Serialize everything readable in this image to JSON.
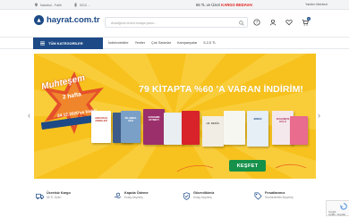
{
  "topbar": {
    "location": "İstanbul - Fatih",
    "phone": "0212 ...",
    "shipping_prefix": "65 TL ve Üzeri",
    "shipping_highlight": "KARGO BEDAVA!",
    "contact": "Yardım Merkezi"
  },
  "header": {
    "logo_text": "hayrat.com.tr",
    "search_placeholder": "Aradığınız ürünü buraya yazın...",
    "cart_count": "0"
  },
  "nav": {
    "all_categories": "TÜM KATEGORİLER",
    "links": [
      "İndirimdekiler",
      "Yeniler",
      "Çok Satanlar",
      "Kampanyalar",
      "5-2,5 TL"
    ]
  },
  "banner": {
    "badge_line1": "Muhteşem",
    "badge_line2": "2 hafta",
    "badge_line3": "24.12.2020'ye kadar",
    "headline": "79 KİTAPTA %60 'A VARAN İNDİRİM!",
    "cta": "KEŞFET",
    "books": [
      {
        "title": "ARKADAŞ ANNELER",
        "color": "#ffffff",
        "text_color": "#c0392b"
      },
      {
        "title": "",
        "color": "#3d5c8a",
        "text_color": "#ffffff"
      },
      {
        "title": "İSLAMDA AİLE",
        "color": "#7aa0c8",
        "text_color": "#ffffff"
      },
      {
        "title": "ZAMANIN KIYMETİ",
        "color": "#9b2f6b",
        "text_color": "#ffffff"
      },
      {
        "title": "",
        "color": "#e8eef2",
        "text_color": "#333333"
      },
      {
        "title": "",
        "color": "#d8232a",
        "text_color": "#ffffff"
      },
      {
        "title": "HZ. RESÛL",
        "color": "#f2ede4",
        "text_color": "#555555"
      },
      {
        "title": "",
        "color": "#f7f7f2",
        "text_color": "#8b3a3a"
      },
      {
        "title": "EDDAİ",
        "color": "#e6eef6",
        "text_color": "#1d4a86"
      },
      {
        "title": "RUHUMUN GÜLÜ",
        "color": "#f4e8ec",
        "text_color": "#b03060"
      },
      {
        "title": "",
        "color": "#e96b8e",
        "text_color": "#ffffff"
      }
    ]
  },
  "features": [
    {
      "title": "Ücretsiz Kargo",
      "sub": "65 TL Üzeri"
    },
    {
      "title": "Kapıda Ödeme",
      "sub": "Kolay Alışveriş"
    },
    {
      "title": "Güvenlikimiz",
      "sub": "Kolay Alışveriş"
    },
    {
      "title": "Fırsatlarımız",
      "sub": "Sürdürülebilir Alışveriş"
    }
  ],
  "recaptcha": {
    "line1": "Google",
    "line2": "Gizlilik - Koşullar"
  },
  "colors": {
    "brand": "#1d4a86",
    "banner_bg": "#f7c21d",
    "cta": "#16914a",
    "highlight": "#e0211b"
  }
}
